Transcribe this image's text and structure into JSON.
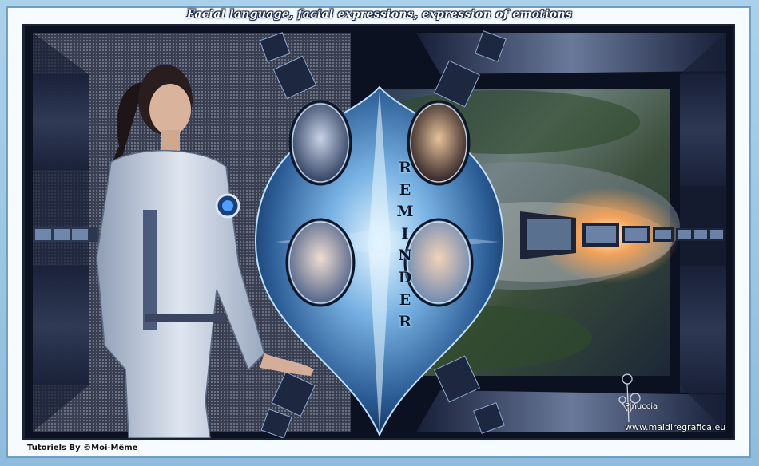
{
  "title": "Facial language, facial expressions, expression of emotions",
  "vertical_word": [
    "R",
    "E",
    "M",
    "I",
    "N",
    "D",
    "E",
    "R"
  ],
  "credit_left": "Tutoriels By ©Moi-Même",
  "watermark": {
    "name": "Pinuccia",
    "url": "www.maidiregrafica.eu"
  },
  "colors": {
    "background": "#9cc6e3",
    "frame_dark": "#0b1120",
    "steel_blue": "#4f7fb4",
    "highlight": "#d9f0ff"
  },
  "icons": {
    "signature_flower": "rose-icon"
  }
}
